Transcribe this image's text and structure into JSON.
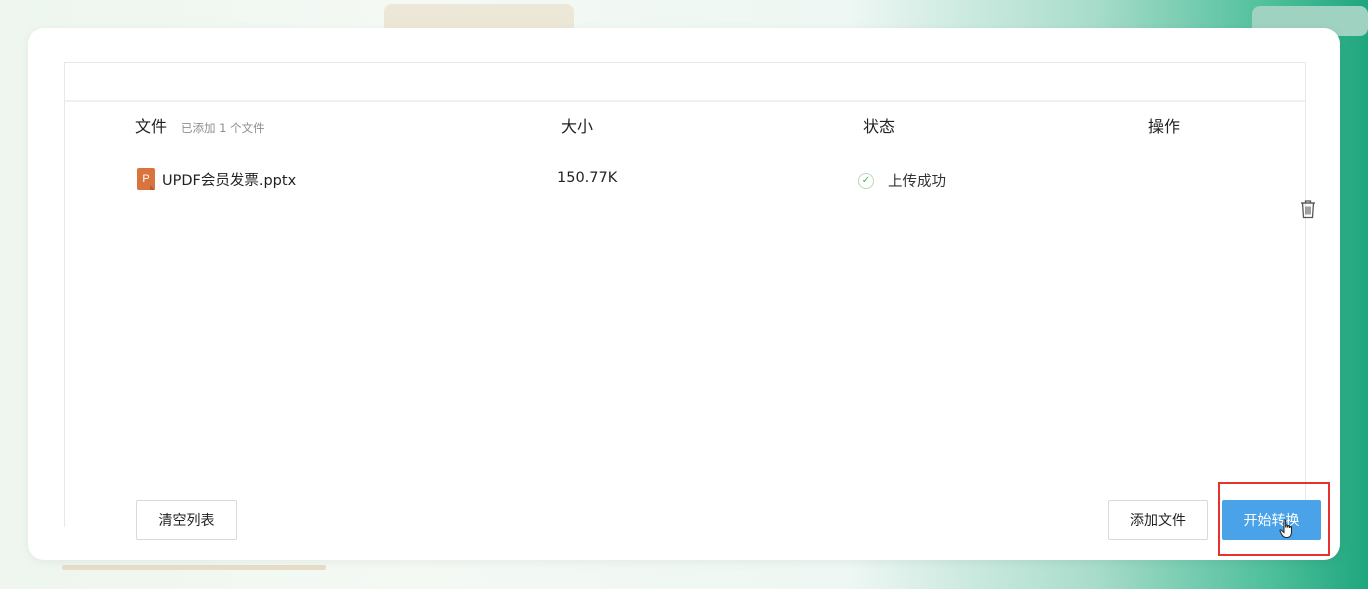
{
  "table": {
    "headers": {
      "file": "文件",
      "file_count": "已添加 1 个文件",
      "size": "大小",
      "status": "状态",
      "operation": "操作"
    },
    "rows": [
      {
        "file_icon_letter": "P",
        "file_name": "UPDF会员发票.pptx",
        "size": "150.77K",
        "status": "上传成功"
      }
    ]
  },
  "actions": {
    "clear_list": "清空列表",
    "add_file": "添加文件",
    "start_convert": "开始转换"
  },
  "icons": {
    "file_type": "pptx-file-icon",
    "status": "check-circle-icon",
    "delete": "trash-icon",
    "pointer": "hand-cursor-icon"
  },
  "colors": {
    "primary_button": "#4aa3e8",
    "highlight_border": "#e5312f",
    "success": "#4caf50",
    "ppt_icon": "#d9743c"
  }
}
